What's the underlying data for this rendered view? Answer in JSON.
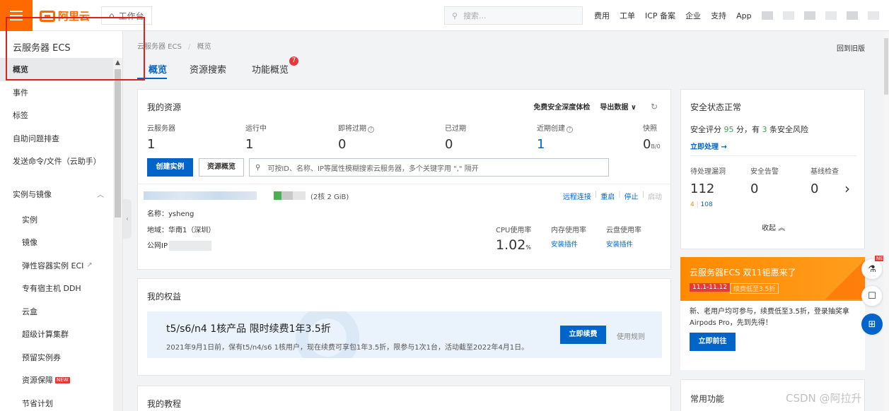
{
  "topbar": {
    "logo": "阿里云",
    "workbench": "工作台",
    "search_placeholder": "搜索...",
    "nav": [
      "费用",
      "工单",
      "ICP 备案",
      "企业",
      "支持",
      "App"
    ]
  },
  "sidebar": {
    "title": "云服务器 ECS",
    "items": [
      "概览",
      "事件",
      "标签",
      "自助问题排查",
      "发送命令/文件（云助手）"
    ],
    "group": "实例与镜像",
    "sub_items": [
      "实例",
      "镜像",
      "弹性容器实例 ECI",
      "专有宿主机 DDH",
      "云盒",
      "超级计算集群",
      "预留实例券",
      "资源保障",
      "节省计划"
    ],
    "new_badge": "NEW"
  },
  "breadcrumb": [
    "云服务器 ECS",
    "概览"
  ],
  "back_old": "回到旧版",
  "tabs": [
    "概览",
    "资源搜索",
    "功能概览"
  ],
  "tab_badge": "7",
  "resources": {
    "title": "我的资源",
    "action_free": "免费安全深度体检",
    "action_export": "导出数据",
    "stats": [
      {
        "label": "云服务器",
        "value": "1"
      },
      {
        "label": "运行中",
        "value": "1"
      },
      {
        "label": "即将过期",
        "value": "0"
      },
      {
        "label": "已过期",
        "value": "0"
      },
      {
        "label": "近期创建",
        "value": "1"
      },
      {
        "label": "快照",
        "value": "0",
        "unit": "B/0"
      }
    ],
    "create_btn": "创建实例",
    "overview_btn": "资源概览",
    "search_placeholder": "可按ID、名称、IP等属性模糊搜索云服务器，多个关键字用 \",\" 隔开",
    "instance": {
      "spec": "(2核 2 GiB)",
      "ops": [
        "远程连接",
        "重启",
        "停止",
        "启动"
      ],
      "name_label": "名称：",
      "name": "ysheng",
      "region_label": "地域：",
      "region": "华南1（深圳）",
      "ip_label": "公网IP",
      "cpu_label": "CPU使用率",
      "cpu_value": "1.02",
      "cpu_unit": "%",
      "mem_label": "内存使用率",
      "disk_label": "云盘使用率",
      "install": "安装插件"
    }
  },
  "benefits": {
    "title": "我的权益",
    "banner_title": "t5/s6/n4 1核产品 限时续费1年3.5折",
    "banner_desc": "2021年9月1日前，保有t5/n4/s6 1核用户，现在续费可享包1年3.5折，限参与1次1台，活动截至2022年4月1日。",
    "renew_btn": "立即续费",
    "rules": "使用规则"
  },
  "tutorial": {
    "title": "我的教程"
  },
  "security": {
    "title": "安全状态正常",
    "score_pre": "安全评分",
    "score": "95",
    "score_mid": "分，有",
    "risk": "3",
    "score_post": "条安全风险",
    "handle": "立即处理",
    "stats": [
      {
        "label": "待处理漏洞",
        "value": "112"
      },
      {
        "label": "安全告警",
        "value": "0"
      },
      {
        "label": "基线检查",
        "value": "0"
      }
    ],
    "sub_a": "4",
    "sub_b": "108",
    "fold": "收起"
  },
  "promo": {
    "title": "云服务器ECS 双11钜惠来了",
    "date": "11.1-11.12",
    "tag": "续费低至3.5折",
    "body": "新、老用户均可参与，续费低至3.5折，登录抽奖拿Airpods Pro，先到先得！",
    "btn": "立即前往"
  },
  "common": {
    "title": "常用功能"
  },
  "watermark": "CSDN @阿拉升",
  "colors": {
    "brand": "#ff6a00",
    "primary": "#0064c8",
    "annotation": "#e02020"
  }
}
